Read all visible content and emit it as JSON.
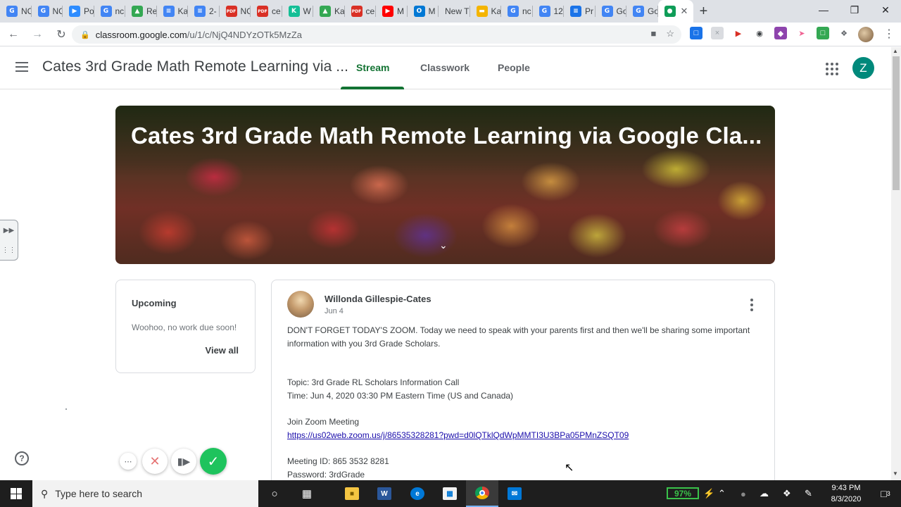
{
  "browser": {
    "tabs": [
      {
        "label": "NC",
        "icon": "google-g-icon",
        "color": "#4285f4"
      },
      {
        "label": "NC",
        "icon": "google-g-icon",
        "color": "#4285f4"
      },
      {
        "label": "Po",
        "icon": "zoom-icon",
        "color": "#2d8cff"
      },
      {
        "label": "nc",
        "icon": "google-g-icon",
        "color": "#4285f4"
      },
      {
        "label": "Re",
        "icon": "drive-icon",
        "color": "#34a853"
      },
      {
        "label": "Ka",
        "icon": "docs-icon",
        "color": "#4285f4"
      },
      {
        "label": "2-",
        "icon": "docs-icon",
        "color": "#4285f4"
      },
      {
        "label": "NC",
        "icon": "pdf-icon",
        "color": "#d93025"
      },
      {
        "label": "ce",
        "icon": "pdf-icon",
        "color": "#d93025"
      },
      {
        "label": "W",
        "icon": "khan-icon",
        "color": "#14bf96"
      },
      {
        "label": "Ka",
        "icon": "drive-icon",
        "color": "#34a853"
      },
      {
        "label": "ce",
        "icon": "pdf-icon",
        "color": "#d93025"
      },
      {
        "label": "M",
        "icon": "youtube-icon",
        "color": "#ff0000"
      },
      {
        "label": "M",
        "icon": "outlook-icon",
        "color": "#0078d4"
      },
      {
        "label": "New T",
        "icon": "",
        "color": ""
      },
      {
        "label": "Ka",
        "icon": "slides-icon",
        "color": "#f4b400"
      },
      {
        "label": "nc",
        "icon": "google-g-icon",
        "color": "#4285f4"
      },
      {
        "label": "12",
        "icon": "google-g-icon",
        "color": "#4285f4"
      },
      {
        "label": "Pr",
        "icon": "sheets-icon",
        "color": "#1a73e8"
      },
      {
        "label": "Go",
        "icon": "google-g-icon",
        "color": "#4285f4"
      },
      {
        "label": "Go",
        "icon": "google-g-icon",
        "color": "#4285f4"
      }
    ],
    "active_tab_icon": "classroom-icon",
    "url_host": "classroom.google.com",
    "url_path": "/u/1/c/NjQ4NDYzOTk5MzZa"
  },
  "header": {
    "class_name": "Cates 3rd Grade Math Remote Learning via ...",
    "tabs": [
      "Stream",
      "Classwork",
      "People"
    ],
    "active_tab": "Stream",
    "avatar_letter": "Z",
    "accent": "#137333"
  },
  "banner": {
    "title": "Cates 3rd Grade Math Remote Learning via Google Cla..."
  },
  "upcoming": {
    "title": "Upcoming",
    "message": "Woohoo, no work due soon!",
    "view_all": "View all"
  },
  "post": {
    "author": "Willonda Gillespie-Cates",
    "date": "Jun 4",
    "body": "DON'T FORGET TODAY'S ZOOM.  Today we need to speak with your parents first and then we'll be sharing some important information with you 3rd Grade Scholars.",
    "topic": "Topic: 3rd Grade RL Scholars Information Call",
    "time": "Time: Jun 4, 2020 03:30 PM Eastern Time (US and Canada)",
    "join": "Join Zoom Meeting",
    "link": "https://us02web.zoom.us/j/86535328281?pwd=d0lQTklQdWpMMTI3U3BPa05PMnZSQT09",
    "meeting_id": "Meeting ID: 865 3532 8281",
    "password": "Password: 3rdGrade"
  },
  "taskbar": {
    "search_placeholder": "Type here to search",
    "battery": "97%",
    "time": "9:43 PM",
    "date": "8/3/2020",
    "notifications": "3"
  }
}
